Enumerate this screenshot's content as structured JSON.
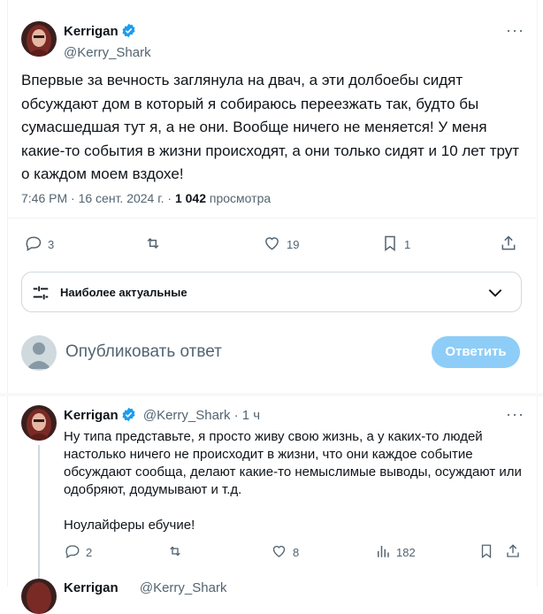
{
  "main_tweet": {
    "author_name": "Kerrigan",
    "author_handle": "@Kerry_Shark",
    "text": "Впервые за вечность заглянула на двач, а эти долбоебы сидят обсуждают дом в который я собираюсь переезжать так, будто бы сумасшедшая тут я, а не они. Вообще ничего не меняется! У меня какие-то события в жизни происходят, а они только сидят и 10 лет трут о каждом моем вздохе!",
    "timestamp": "7:46 PM · 16 сент. 2024 г. · ",
    "views_count": "1 042",
    "views_label": " просмотра",
    "replies": "3",
    "retweets": "",
    "likes": "19",
    "bookmarks": "1"
  },
  "sort": {
    "label": "Наиболее актуальные"
  },
  "compose": {
    "placeholder": "Опубликовать ответ",
    "button": "Ответить"
  },
  "reply_tweet": {
    "author_name": "Kerrigan",
    "author_handle": "@Kerry_Shark",
    "time": " · 1 ч",
    "paragraph1": "Ну типа представьте, я просто живу свою жизнь, а у каких-то людей настолько ничего не происходит в жизни, что они каждое событие обсуждают сообща, делают какие-то немыслимые выводы, осуждают или одобряют, додумывают и т.д.",
    "paragraph2": "Ноулайферы ебучие!",
    "replies": "2",
    "likes": "8",
    "views": "182"
  },
  "next_tweet": {
    "author_name": "Kerrigan",
    "author_handle": "@Kerry_Shark"
  },
  "colors": {
    "accent": "#1d9bf0",
    "button_disabled": "#8ecdf8",
    "muted": "#536471"
  }
}
